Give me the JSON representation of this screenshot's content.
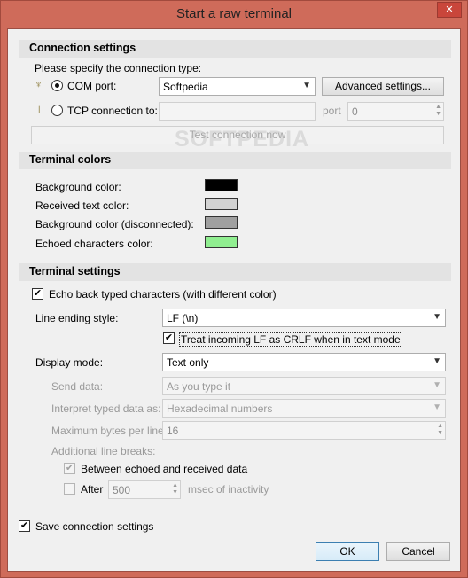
{
  "window": {
    "title": "Start a raw terminal",
    "close_glyph": "✕"
  },
  "connection": {
    "section_title": "Connection settings",
    "prompt": "Please specify the connection type:",
    "com_label": "COM port:",
    "com_value": "Softpedia",
    "advanced_button": "Advanced settings...",
    "tcp_label": "TCP connection to:",
    "port_label": "port",
    "port_value": "0",
    "test_button": "Test connection now"
  },
  "colors": {
    "section_title": "Terminal colors",
    "items": [
      {
        "label": "Background color:",
        "color": "#000000"
      },
      {
        "label": "Received text color:",
        "color": "#d3d3d3"
      },
      {
        "label": "Background color (disconnected):",
        "color": "#a0a0a0"
      },
      {
        "label": "Echoed characters color:",
        "color": "#90ee90"
      }
    ]
  },
  "terminal": {
    "section_title": "Terminal settings",
    "echo_label": "Echo back typed characters (with different color)",
    "line_ending_label": "Line ending style:",
    "line_ending_value": "LF (\\n)",
    "treat_lf_label": "Treat incoming LF as CRLF when in text mode",
    "display_mode_label": "Display mode:",
    "display_mode_value": "Text only",
    "send_data_label": "Send data:",
    "send_data_value": "As you type it",
    "interpret_label": "Interpret typed data as:",
    "interpret_value": "Hexadecimal numbers",
    "max_bytes_label": "Maximum bytes per line:",
    "max_bytes_value": "16",
    "additional_label": "Additional line breaks:",
    "between_label": "Between echoed and received data",
    "after_label": "After",
    "after_value": "500",
    "msec_label": "msec of inactivity"
  },
  "footer": {
    "save_label": "Save connection settings",
    "ok_button": "OK",
    "cancel_button": "Cancel"
  },
  "watermark": "SOFTPEDIA"
}
